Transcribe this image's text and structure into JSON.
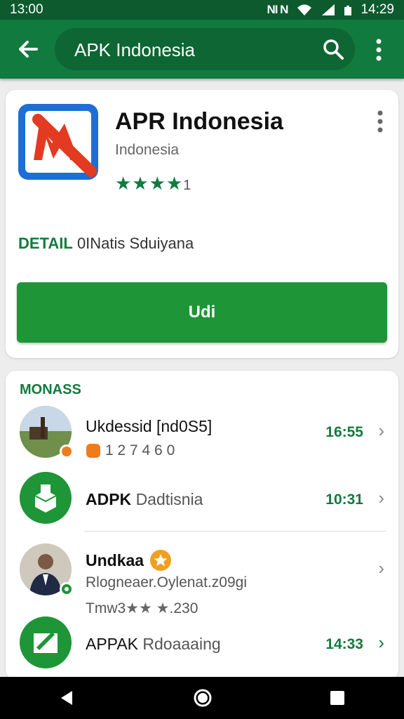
{
  "status": {
    "time": "13:00",
    "net_icons": "NI N",
    "clock": "14:29"
  },
  "appbar": {
    "query": "APK Indonesia"
  },
  "app": {
    "title": "APR Indonesia",
    "subtitle": "Indonesia",
    "stars": "★★★★",
    "rating_count": "1",
    "detail_label": "DETAIL",
    "detail_text": "0INatis Sduiyana",
    "install_label": "Udi"
  },
  "section": {
    "title": "MONASS",
    "items": [
      {
        "title": "Ukdessid [nd0S5]",
        "sub": "1 2 7 4 6 0",
        "time": "16:55"
      },
      {
        "title_bold": "ADPK",
        "title_rest": "Dadtisnia",
        "time": "10:31"
      },
      {
        "title": "Undkaa",
        "sub": "Rlogneaer.Oylenat.z09gi",
        "sub2_prefix": "Tmw3",
        "sub2_stars": "★★ ★",
        "sub2_num": ".230"
      },
      {
        "title_bold": "APPAK",
        "title_rest": "Rdoaaaing",
        "time": "14:33"
      }
    ]
  },
  "colors": {
    "primary": "#117a3e",
    "accent": "#1e9537",
    "statusbar": "#0d5a2e"
  }
}
